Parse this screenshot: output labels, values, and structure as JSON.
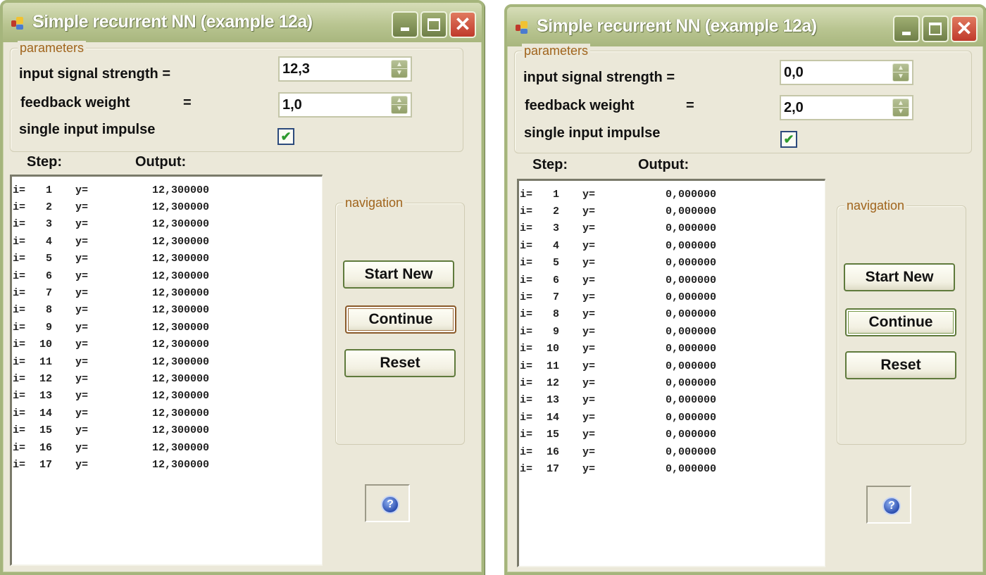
{
  "windows": [
    {
      "title": "Simple recurrent NN (example 12a)",
      "caption_buttons": {
        "minimize": "minimize",
        "maximize": "maximize",
        "close": "✕"
      },
      "parameters": {
        "legend": "parameters",
        "input_signal_label": "input signal strength =",
        "input_signal_value": "12,3",
        "feedback_label": "feedback weight",
        "feedback_eq": "=",
        "feedback_value": "1,0",
        "impulse_label": "single input impulse",
        "impulse_checked": true,
        "check_glyph": "✔"
      },
      "columns": {
        "step": "Step:",
        "output": "Output:"
      },
      "rows": [
        {
          "i": "i=",
          "n": "1",
          "y": "y=",
          "v": "12,300000"
        },
        {
          "i": "i=",
          "n": "2",
          "y": "y=",
          "v": "12,300000"
        },
        {
          "i": "i=",
          "n": "3",
          "y": "y=",
          "v": "12,300000"
        },
        {
          "i": "i=",
          "n": "4",
          "y": "y=",
          "v": "12,300000"
        },
        {
          "i": "i=",
          "n": "5",
          "y": "y=",
          "v": "12,300000"
        },
        {
          "i": "i=",
          "n": "6",
          "y": "y=",
          "v": "12,300000"
        },
        {
          "i": "i=",
          "n": "7",
          "y": "y=",
          "v": "12,300000"
        },
        {
          "i": "i=",
          "n": "8",
          "y": "y=",
          "v": "12,300000"
        },
        {
          "i": "i=",
          "n": "9",
          "y": "y=",
          "v": "12,300000"
        },
        {
          "i": "i=",
          "n": "10",
          "y": "y=",
          "v": "12,300000"
        },
        {
          "i": "i=",
          "n": "11",
          "y": "y=",
          "v": "12,300000"
        },
        {
          "i": "i=",
          "n": "12",
          "y": "y=",
          "v": "12,300000"
        },
        {
          "i": "i=",
          "n": "13",
          "y": "y=",
          "v": "12,300000"
        },
        {
          "i": "i=",
          "n": "14",
          "y": "y=",
          "v": "12,300000"
        },
        {
          "i": "i=",
          "n": "15",
          "y": "y=",
          "v": "12,300000"
        },
        {
          "i": "i=",
          "n": "16",
          "y": "y=",
          "v": "12,300000"
        },
        {
          "i": "i=",
          "n": "17",
          "y": "y=",
          "v": "12,300000"
        }
      ],
      "navigation": {
        "legend": "navigation",
        "start_new": "Start New",
        "continue": "Continue",
        "reset": "Reset"
      },
      "help_glyph": "?"
    },
    {
      "title": "Simple recurrent NN (example 12a)",
      "caption_buttons": {
        "minimize": "minimize",
        "maximize": "maximize",
        "close": "✕"
      },
      "parameters": {
        "legend": "parameters",
        "input_signal_label": "input signal strength =",
        "input_signal_value": "0,0",
        "feedback_label": "feedback weight",
        "feedback_eq": "=",
        "feedback_value": "2,0",
        "impulse_label": "single input impulse",
        "impulse_checked": true,
        "check_glyph": "✔"
      },
      "columns": {
        "step": "Step:",
        "output": "Output:"
      },
      "rows": [
        {
          "i": "i=",
          "n": "1",
          "y": "y=",
          "v": "0,000000"
        },
        {
          "i": "i=",
          "n": "2",
          "y": "y=",
          "v": "0,000000"
        },
        {
          "i": "i=",
          "n": "3",
          "y": "y=",
          "v": "0,000000"
        },
        {
          "i": "i=",
          "n": "4",
          "y": "y=",
          "v": "0,000000"
        },
        {
          "i": "i=",
          "n": "5",
          "y": "y=",
          "v": "0,000000"
        },
        {
          "i": "i=",
          "n": "6",
          "y": "y=",
          "v": "0,000000"
        },
        {
          "i": "i=",
          "n": "7",
          "y": "y=",
          "v": "0,000000"
        },
        {
          "i": "i=",
          "n": "8",
          "y": "y=",
          "v": "0,000000"
        },
        {
          "i": "i=",
          "n": "9",
          "y": "y=",
          "v": "0,000000"
        },
        {
          "i": "i=",
          "n": "10",
          "y": "y=",
          "v": "0,000000"
        },
        {
          "i": "i=",
          "n": "11",
          "y": "y=",
          "v": "0,000000"
        },
        {
          "i": "i=",
          "n": "12",
          "y": "y=",
          "v": "0,000000"
        },
        {
          "i": "i=",
          "n": "13",
          "y": "y=",
          "v": "0,000000"
        },
        {
          "i": "i=",
          "n": "14",
          "y": "y=",
          "v": "0,000000"
        },
        {
          "i": "i=",
          "n": "15",
          "y": "y=",
          "v": "0,000000"
        },
        {
          "i": "i=",
          "n": "16",
          "y": "y=",
          "v": "0,000000"
        },
        {
          "i": "i=",
          "n": "17",
          "y": "y=",
          "v": "0,000000"
        }
      ],
      "navigation": {
        "legend": "navigation",
        "start_new": "Start New",
        "continue": "Continue",
        "reset": "Reset"
      },
      "help_glyph": "?"
    }
  ],
  "colors": {
    "window_bg": "#ebe8d9",
    "title_green": "#b9c591",
    "legend_orange": "#a0641c",
    "close_red": "#c0392b",
    "check_green": "#2e9a2e"
  }
}
